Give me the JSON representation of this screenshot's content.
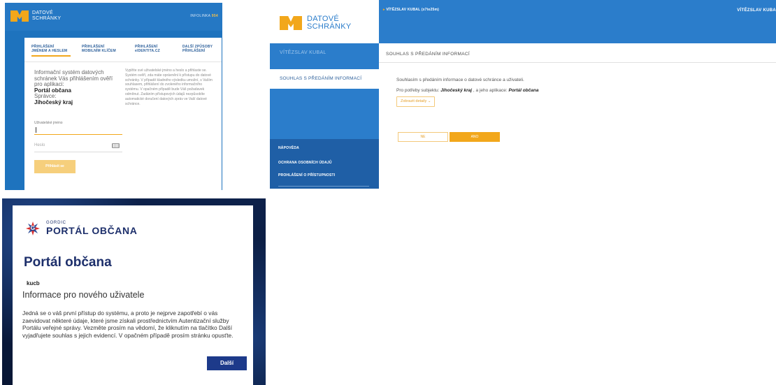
{
  "colors": {
    "accent_yellow": "#f2a71b",
    "ds_blue": "#2b7dcb",
    "ds_blue_dark": "#1f5fa6",
    "portal_navy": "#1d2f6b",
    "portal_button": "#1d3a8a"
  },
  "login": {
    "logo": [
      "DATOVÉ",
      "SCHRÁNKY"
    ],
    "infoline_label": "INFOLINKA",
    "infoline_number": "954",
    "tabs": [
      {
        "label": "PŘIHLÁŠENÍ JMÉNEM A HESLEM"
      },
      {
        "label": "PŘIHLÁŠENÍ MOBILNÍM KLÍČEM"
      },
      {
        "label": "PŘIHLÁŠENÍ eIDENTITA.CZ"
      },
      {
        "label": "DALŠÍ ZPŮSOBY PŘIHLÁŠENÍ"
      }
    ],
    "info_text": "Informační systém datových schránek Vás přihlášením ověří pro aplikaci:",
    "app_name": "Portál občana",
    "admin_label": "Správce:",
    "admin_name": "Jihočeský kraj",
    "description": "Vyplňte své uživatelské jméno a heslo a přihlaste se. Systém ověří, zda máte oprávnění k přístupu do datové schránky. V případě kladného výsledku umožní, s Vaším souhlasem, přihlášení do zvoleného informačního systému. V opačném případě bude Váš požadavek odmítnut. Zadáním přístupových údajů nezpůsobíte automatické doručení datových zpráv ve Vaší datové schránce.",
    "username_label": "Uživatelské jméno",
    "username_value": "",
    "password_placeholder": "Heslo",
    "login_button": "Přihlásit se"
  },
  "consent": {
    "logo": [
      "DATOVÉ",
      "SCHRÁNKY"
    ],
    "topbar_user": "VÍTĚZSLAV KUBAL (x7te25m)",
    "topbar_user_right": "VÍTĚZSLAV KUBA",
    "sidebar_name": "VÍTĚZSLAV KUBAL",
    "sidebar_active": "SOUHLAS S PŘEDÁNÍM INFORMACÍ",
    "sidebar_links": [
      "NÁPOVĚDA",
      "OCHRANA OSOBNÍCH ÚDAJŮ",
      "PROHLÁŠENÍ O PŘÍSTUPNOSTI"
    ],
    "page_title": "SOUHLAS S PŘEDÁNÍM INFORMACÍ",
    "consent_text": "Souhlasím s předáním informace o datové schránce a uživateli.",
    "purpose_prefix": "Pro potřeby subjektu:",
    "purpose_subject": "Jihočeský kraj",
    "purpose_middle": ", a jeho aplikace:",
    "purpose_app": "Portál občana",
    "details_button": "Zobrazit detaily",
    "no_button": "NE",
    "yes_button": "ANO"
  },
  "portal": {
    "brand_small": "GORDIC",
    "brand_big": "PORTÁL OBČANA",
    "brand_glyph": "G",
    "title": "Portál občana",
    "username": "kucb",
    "subtitle": "Informace pro nového uživatele",
    "body": "Jedná se o váš první přístup do systému, a proto je nejprve zapotřebí o vás zaevidovat některé údaje, které jsme získali prostřednictvím Autentizační služby Portálu veřejné správy. Vezměte prosím na vědomí, že kliknutím na tlačítko Další vyjadřujete souhlas s jejich evidencí. V opačném případě prosím stránku opusťte.",
    "next_button": "Další"
  }
}
